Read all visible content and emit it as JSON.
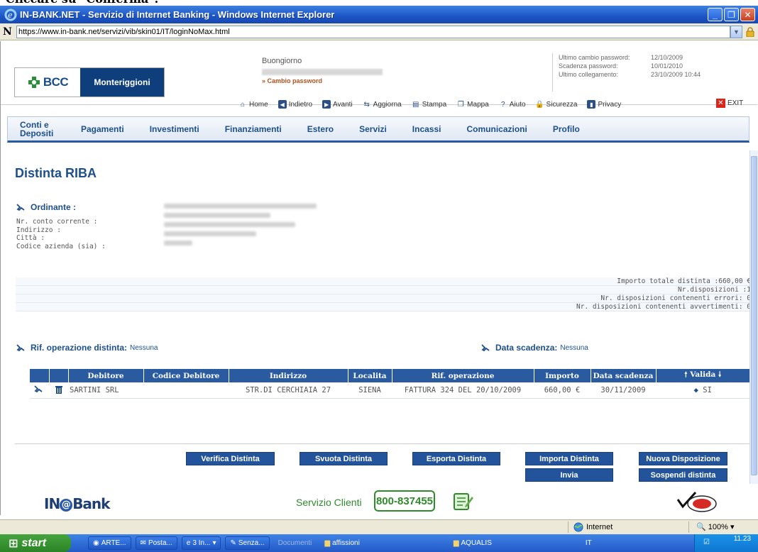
{
  "caption": "Cliccare su \"Conferma\".",
  "window": {
    "title": "IN-BANK.NET - Servizio di Internet Banking - Windows Internet Explorer",
    "url": "https://www.in-bank.net/servizi/vib/skin01/IT/loginNoMax.html"
  },
  "bank": {
    "logo_short": "BCC",
    "logo_name": "Monteriggioni",
    "greeting": "Buongiorno",
    "change_password": "» Cambio password",
    "info": [
      {
        "label": "Ultimo cambio password:",
        "value": "12/10/2009"
      },
      {
        "label": "Scadenza password:",
        "value": "10/01/2010"
      },
      {
        "label": "Ultimo collegamento:",
        "value": "23/10/2009 10:44"
      }
    ]
  },
  "toolbar": {
    "home": "Home",
    "back": "Indietro",
    "forward": "Avanti",
    "refresh": "Aggiorna",
    "print": "Stampa",
    "map": "Mappa",
    "help": "Aiuto",
    "security": "Sicurezza",
    "privacy": "Privacy",
    "exit": "EXIT"
  },
  "nav": [
    "Conti e Depositi",
    "Pagamenti",
    "Investimenti",
    "Finanziamenti",
    "Estero",
    "Servizi",
    "Incassi",
    "Comunicazioni",
    "Profilo"
  ],
  "page_title": "Distinta RIBA",
  "ordinante": {
    "label": "Ordinante :",
    "fields": [
      "Nr. conto corrente :",
      "Indirizzo :",
      "Città :",
      "Codice azienda (sia) :"
    ]
  },
  "summary": {
    "importo": "Importo totale distinta :660,00 €",
    "disposizioni": "Nr.disposizioni :1",
    "errori": "Nr. disposizioni contenenti errori: 0",
    "avvertimenti": "Nr. disposizioni contenenti avvertimenti: 0"
  },
  "rif": {
    "label": "Rif. operazione distinta:",
    "value": "Nessuna"
  },
  "scadenza": {
    "label": "Data scadenza:",
    "value": "Nessuna"
  },
  "table": {
    "headers": [
      "Debitore",
      "Codice Debitore",
      "Indirizzo",
      "Localita",
      "Rif. operazione",
      "Importo",
      "Data scadenza",
      "Valida"
    ],
    "rows": [
      {
        "debitore": "SARTINI SRL",
        "codice": "",
        "indirizzo": "STR.DI CERCHIAIA 27",
        "localita": "SIENA",
        "rif": "FATTURA 324 DEL 20/10/2009",
        "importo": "660,00 €",
        "scadenza": "30/11/2009",
        "valida": "SI"
      }
    ]
  },
  "buttons": {
    "verifica": "Verifica Distinta",
    "svuota": "Svuota Distinta",
    "esporta": "Esporta Distinta",
    "importa": "Importa Distinta",
    "nuova": "Nuova Disposizione",
    "invia": "Invia",
    "sospendi": "Sospendi distinta"
  },
  "footer": {
    "brand_prefix": "IN",
    "brand_suffix": "Bank",
    "servizio": "Servizio Clienti",
    "phone": "800-837455"
  },
  "statusbar": {
    "zone": "Internet",
    "zoom": "100%"
  },
  "taskbar": {
    "start": "start",
    "tasks": [
      "ARTE...",
      "Posta...",
      "3 In...",
      "Senza..."
    ],
    "muted_tasks": [
      "Documenti",
      "affissioni",
      "AQUALIS"
    ],
    "lang": "IT",
    "clock": "11.23"
  },
  "colors": {
    "brand_blue": "#1c4f8c",
    "button_blue": "#23549b",
    "header_blue": "#2a5aa0",
    "green": "#2f8a2c",
    "exit_red": "#d9261c"
  }
}
